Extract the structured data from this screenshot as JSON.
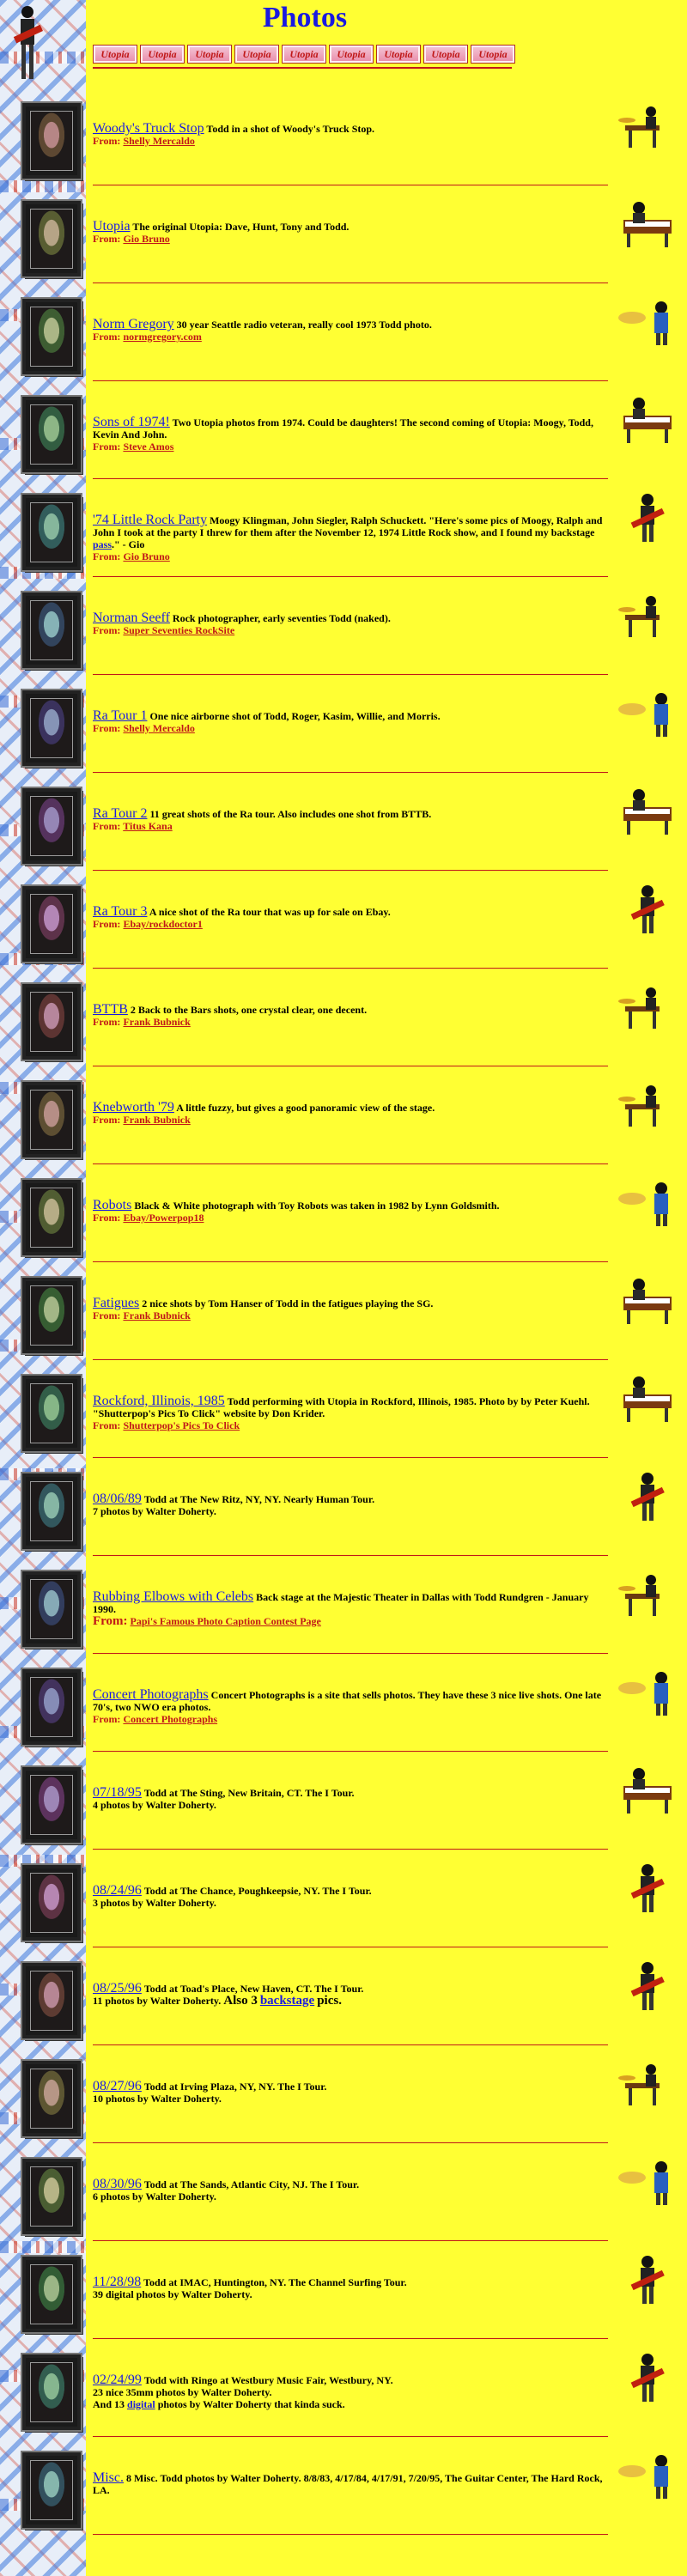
{
  "page": {
    "title": "Photos"
  },
  "header": {
    "logo_tiles": [
      "Utopia",
      "Utopia",
      "Utopia",
      "Utopia",
      "Utopia",
      "Utopia",
      "Utopia",
      "Utopia",
      "Utopia"
    ]
  },
  "colors": {
    "background": "#ffff33",
    "link": "#1a1ae0",
    "from": "#c01818"
  },
  "icons": [
    "guitarist-icon",
    "keyboardist-icon",
    "drummer-icon",
    "singer-icon"
  ],
  "entries": [
    {
      "title": "Woody's Truck Stop",
      "desc": "Todd in a shot of Woody's Truck Stop.",
      "from": "Shelly Mercaldo",
      "icon": "drummer-icon"
    },
    {
      "title": "Utopia",
      "desc": "The original Utopia: Dave, Hunt, Tony and Todd.",
      "from": "Gio Bruno",
      "icon": "keyboardist-icon"
    },
    {
      "title": "Norm Gregory",
      "desc": "30 year Seattle radio veteran, really cool 1973 Todd photo.",
      "from": "normgregory.com",
      "icon": "singer-icon"
    },
    {
      "title": "Sons of 1974!",
      "desc": "Two Utopia photos from 1974. Could be daughters! The second coming of Utopia: Moogy, Todd, Kevin And John.",
      "from": "Steve Amos",
      "icon": "keyboardist-icon"
    },
    {
      "title": "'74 Little Rock Party",
      "desc_pre": "Moogy Klingman, John Siegler, Ralph Schuckett. \"Here's some pics of Moogy, Ralph and John I took at the party I threw for them after the November 12, 1974 Little Rock show, and I found my backstage ",
      "desc_link": "pass",
      "desc_post": ".\" - Gio",
      "from": "Gio Bruno",
      "icon": "guitarist-icon"
    },
    {
      "title": "Norman Seeff",
      "desc": "Rock photographer, early seventies Todd (naked).",
      "from": "Super Seventies RockSite",
      "icon": "drummer-icon"
    },
    {
      "title": "Ra Tour 1",
      "desc": "One nice airborne shot of Todd, Roger, Kasim, Willie, and Morris.",
      "from": "Shelly Mercaldo",
      "icon": "singer-icon"
    },
    {
      "title": "Ra Tour 2",
      "desc": "11 great shots of the Ra tour. Also includes one shot from BTTB.",
      "from": "Titus Kana",
      "icon": "keyboardist-icon"
    },
    {
      "title": "Ra Tour 3",
      "desc": "A nice shot of the Ra tour that was up for sale on Ebay.",
      "from": "Ebay/rockdoctor1",
      "icon": "guitarist-icon"
    },
    {
      "title": "BTTB",
      "desc": "2 Back to the Bars shots, one crystal clear, one decent.",
      "from": "Frank Bubnick",
      "icon": "drummer-icon"
    },
    {
      "title": "Knebworth '79",
      "desc": "A little fuzzy, but gives a good panoramic view of the stage.",
      "from": "Frank Bubnick",
      "icon": "drummer-icon"
    },
    {
      "title": "Robots",
      "desc": "Black & White photograph with Toy Robots was taken in 1982 by Lynn Goldsmith.",
      "from": "Ebay/Powerpop18",
      "icon": "singer-icon"
    },
    {
      "title": "Fatigues",
      "desc": "2 nice shots by Tom Hanser of Todd in the fatigues playing the SG.",
      "from": "Frank Bubnick",
      "icon": "keyboardist-icon"
    },
    {
      "title": "Rockford, Illinois, 1985",
      "desc": "Todd performing with Utopia in Rockford, Illinois, 1985. Photo by by Peter Kuehl. \"Shutterpop's Pics To Click\" website by Don Krider.",
      "from": "Shutterpop's Pics To Click",
      "icon": "keyboardist-icon"
    },
    {
      "title": "08/06/89",
      "desc": "Todd at The New Ritz, NY, NY. Nearly Human Tour.",
      "desc2": "7 photos by Walter Doherty.",
      "icon": "guitarist-icon"
    },
    {
      "title": "Rubbing Elbows with Celebs",
      "desc": "Back stage at the Majestic Theater in Dallas with Todd Rundgren - January 1990.",
      "from": "Papi's Famous Photo Caption Contest Page",
      "big_from": true,
      "icon": "drummer-icon"
    },
    {
      "title": "Concert Photographs",
      "desc": "Concert Photographs is a site that sells photos. They have these 3 nice live shots. One late 70's, two NWO era photos.",
      "from": "Concert Photographs",
      "normal_desc": true,
      "icon": "singer-icon"
    },
    {
      "title": "07/18/95",
      "desc": "Todd at The Sting, New Britain, CT. The I Tour.",
      "desc2": "4 photos by Walter Doherty.",
      "icon": "keyboardist-icon"
    },
    {
      "title": "08/24/96",
      "desc": "Todd at The Chance, Poughkeepsie, NY. The I Tour.",
      "desc2": "3 photos by Walter Doherty.",
      "icon": "guitarist-icon"
    },
    {
      "title": "08/25/96",
      "desc": "Todd at Toad's Place, New Haven, CT. The I Tour.",
      "desc2": "11 photos by Walter Doherty.",
      "desc2_big": "Also 3",
      "desc2_link": "backstage",
      "desc2_tail": "pics.",
      "icon": "guitarist-icon"
    },
    {
      "title": "08/27/96",
      "desc": "Todd at Irving Plaza, NY, NY. The I Tour.",
      "desc2": "10 photos by Walter Doherty.",
      "icon": "drummer-icon"
    },
    {
      "title": "08/30/96",
      "desc": "Todd at The Sands, Atlantic City, NJ. The I Tour.",
      "desc2": "6 photos by Walter Doherty.",
      "icon": "singer-icon"
    },
    {
      "title": "11/28/98",
      "desc": "Todd at IMAC, Huntington, NY. The Channel Surfing Tour.",
      "desc2": "39 digital photos by Walter Doherty.",
      "icon": "guitarist-icon"
    },
    {
      "title": "02/24/99",
      "desc": "Todd with Ringo at Westbury Music Fair, Westbury, NY.",
      "desc2": "23 nice 35mm photos by Walter Doherty.",
      "desc3_pre": "And 13",
      "desc3_link": "digital",
      "desc3_post": "photos by Walter Doherty that kinda suck.",
      "icon": "guitarist-icon"
    },
    {
      "title": "Misc.",
      "desc": "8 Misc. Todd photos by Walter Doherty. 8/8/83, 4/17/84, 4/17/91, 7/20/95, The Guitar Center, The Hard Rock, LA.",
      "icon": "singer-icon"
    }
  ],
  "labels": {
    "from": "From:"
  }
}
